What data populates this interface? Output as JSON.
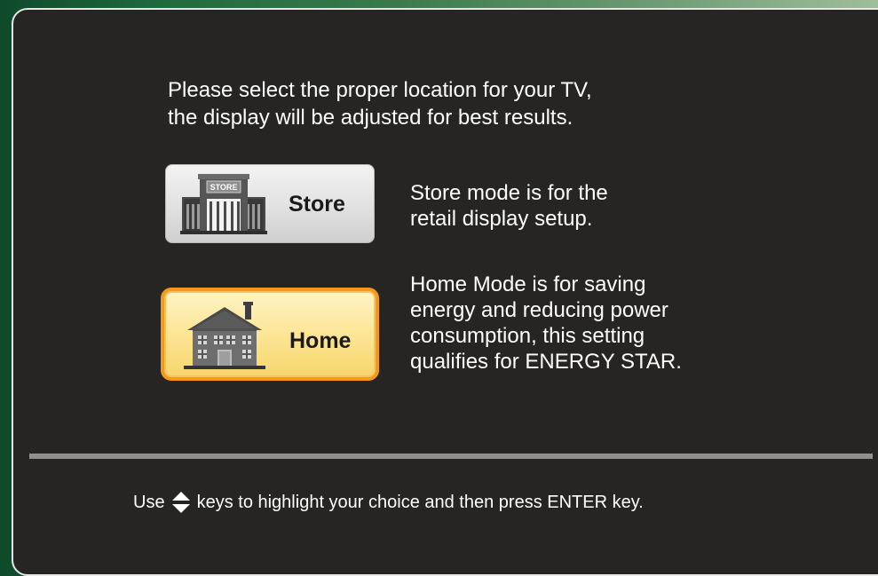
{
  "instructions": {
    "line1": "Please select the proper location for your TV,",
    "line2": "the display will be adjusted for best results."
  },
  "store": {
    "label": "Store",
    "sign_text": "STORE",
    "icon": "store-building-icon",
    "desc_line1": "Store mode is for the",
    "desc_line2": "retail display setup."
  },
  "home": {
    "label": "Home",
    "icon": "house-icon",
    "selected": true,
    "desc_line1": "Home Mode is for saving",
    "desc_line2": "energy and reducing power",
    "desc_line3": "consumption, this setting",
    "desc_line4": "qualifies for ENERGY STAR."
  },
  "footer": {
    "before": "Use",
    "arrows_icon": "up-down-arrows-icon",
    "after": "keys to highlight your choice and then press ENTER key."
  },
  "colors": {
    "panel": "#262524",
    "selected_border": "#f39a1c",
    "selected_fill": "#fde79a",
    "unselected_fill": "#e1e1e1",
    "divider": "#8f8f8f"
  }
}
